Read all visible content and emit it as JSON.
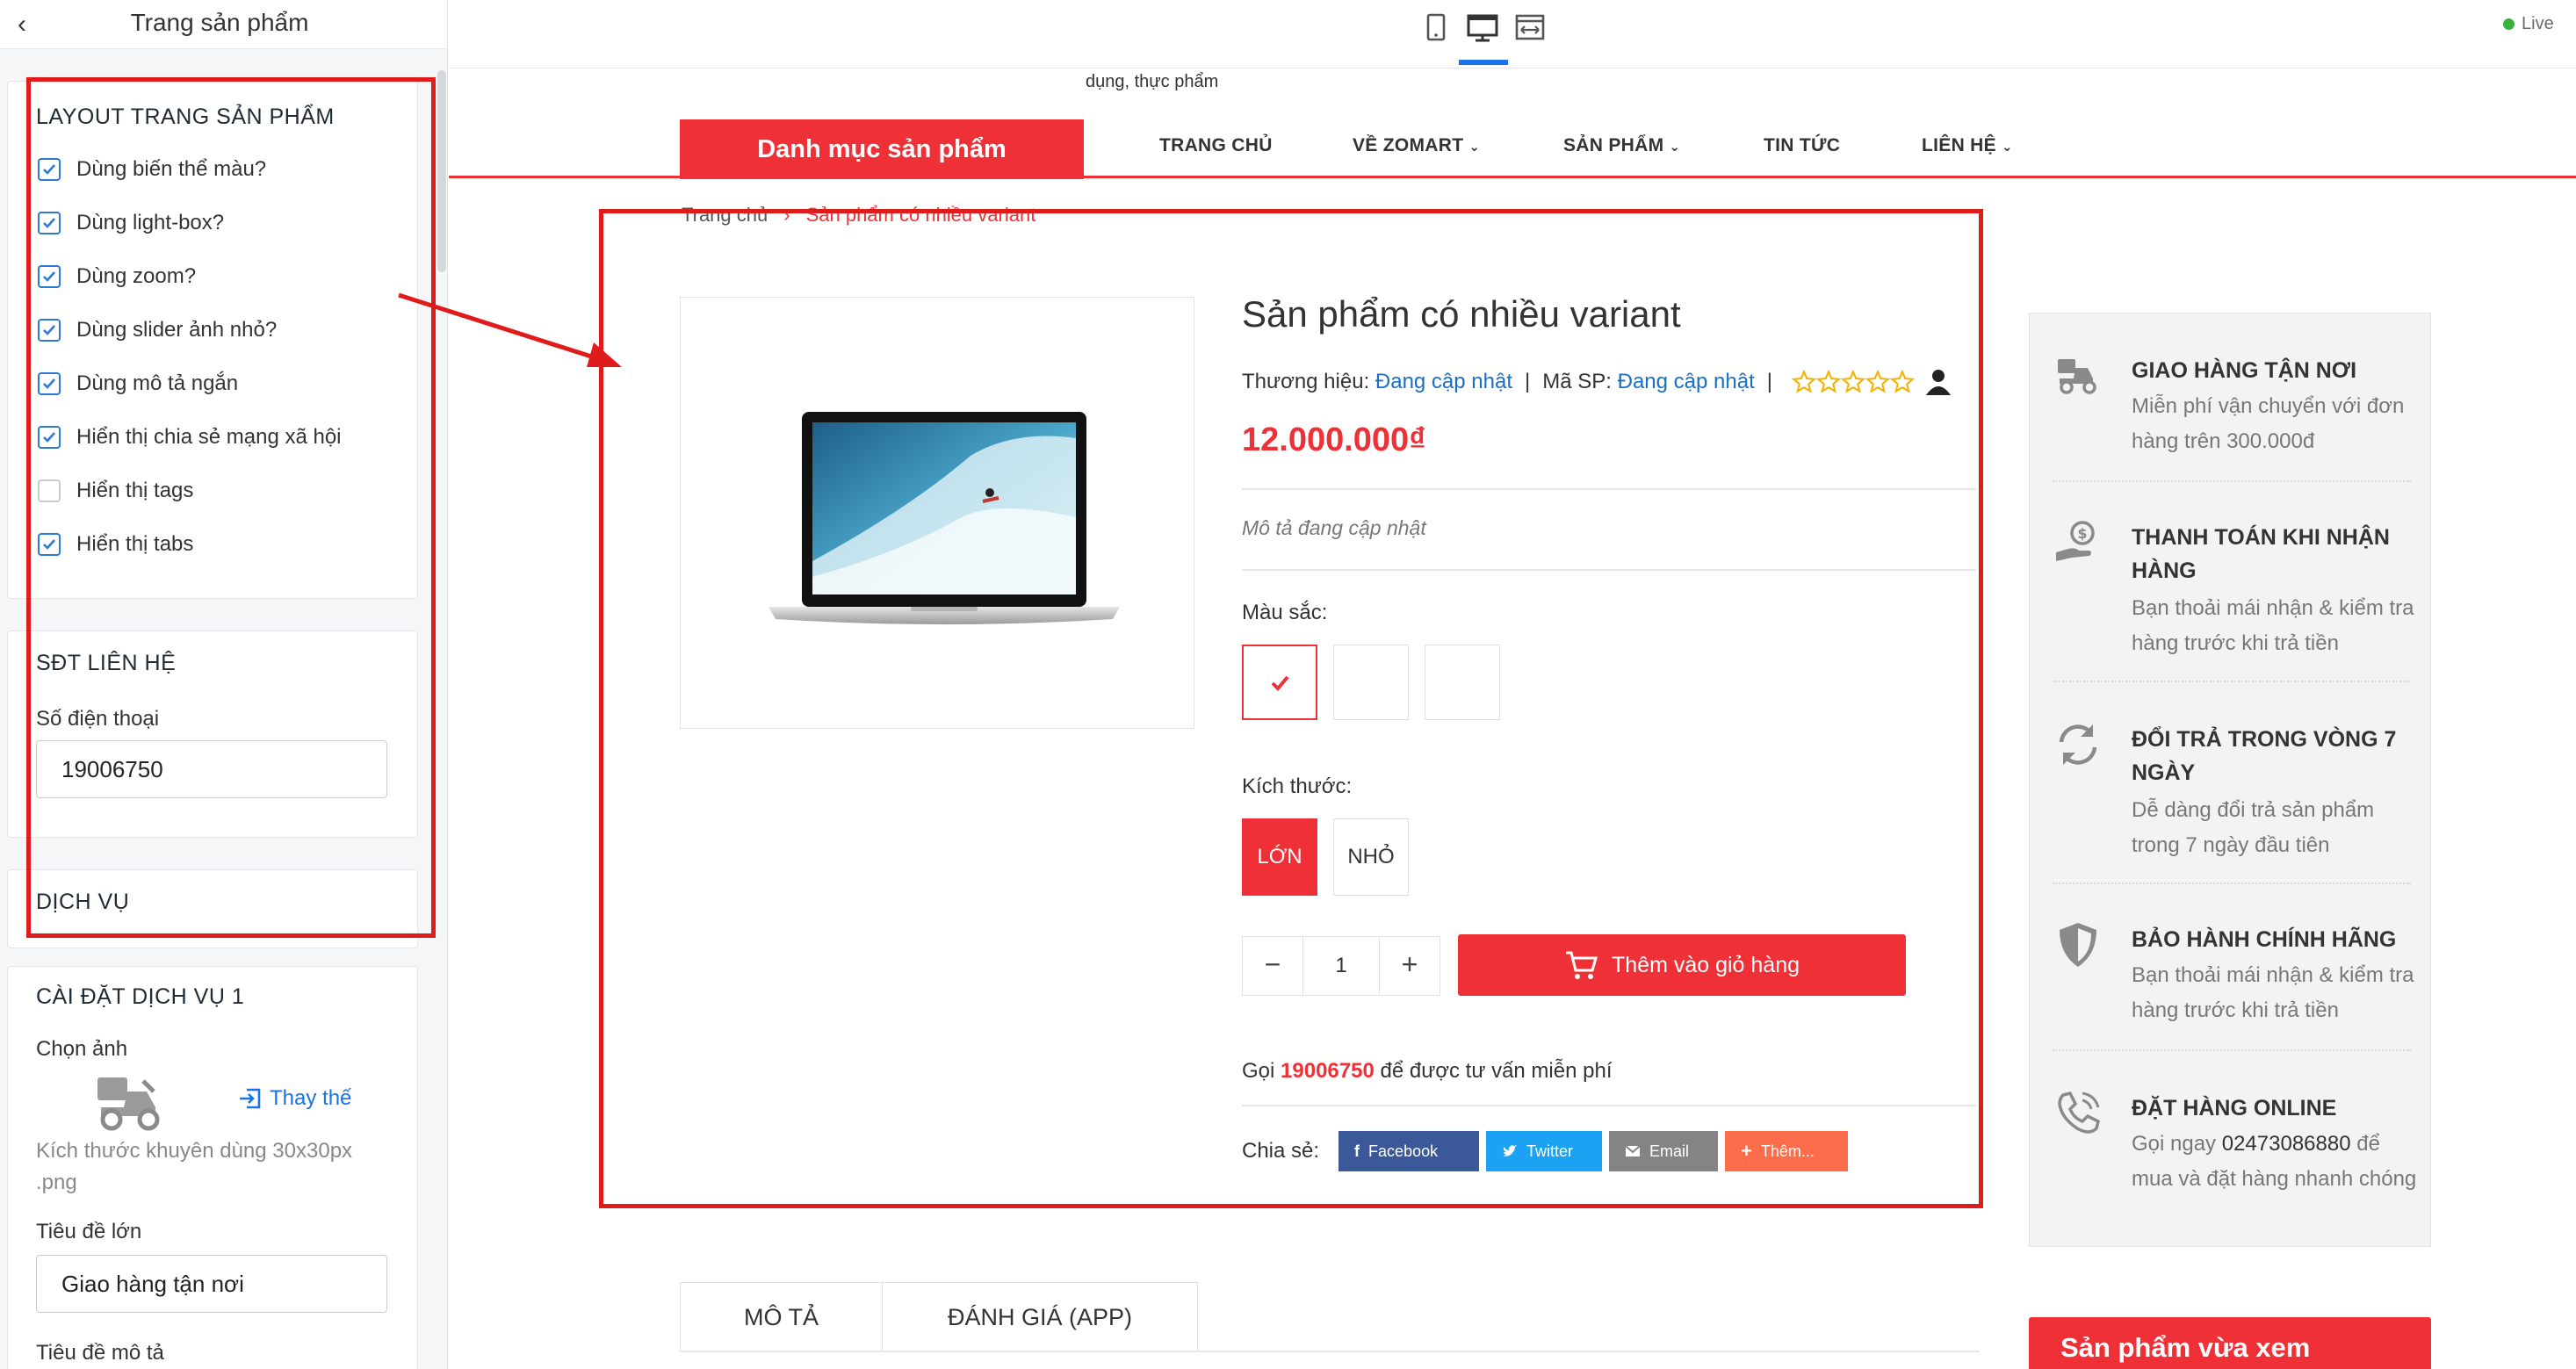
{
  "sidebar": {
    "title": "Trang sản phẩm",
    "layout_section": {
      "title": "LAYOUT TRANG SẢN PHẨM",
      "options": [
        {
          "label": "Dùng biến thể màu?",
          "checked": true
        },
        {
          "label": "Dùng light-box?",
          "checked": true
        },
        {
          "label": "Dùng zoom?",
          "checked": true
        },
        {
          "label": "Dùng slider ảnh nhỏ?",
          "checked": true
        },
        {
          "label": "Dùng mô tả ngắn",
          "checked": true
        },
        {
          "label": "Hiển thị chia sẻ mạng xã hội",
          "checked": true
        },
        {
          "label": "Hiển thị tags",
          "checked": false
        },
        {
          "label": "Hiển thị tabs",
          "checked": true
        }
      ]
    },
    "phone_section": {
      "title": "SĐT LIÊN HỆ",
      "field_label": "Số điện thoại",
      "field_value": "19006750"
    },
    "services_section": {
      "title": "DỊCH VỤ"
    },
    "service1_section": {
      "title": "CÀI ĐẶT DỊCH VỤ 1",
      "image_label": "Chọn ảnh",
      "replace_label": "Thay thế",
      "size_hint": "Kích thước khuyên dùng 30x30px .png",
      "big_title_label": "Tiêu đề lớn",
      "big_title_value": "Giao hàng tận nơi",
      "desc_title_label": "Tiêu đề mô tả"
    }
  },
  "topbar": {
    "live_label": "Live"
  },
  "site": {
    "tagline": "dụng, thực phẩm",
    "category_button": "Danh mục sản phẩm",
    "nav": [
      {
        "label": "TRANG CHỦ",
        "dropdown": false
      },
      {
        "label": "VỀ ZOMART",
        "dropdown": true
      },
      {
        "label": "SẢN PHẨM",
        "dropdown": true
      },
      {
        "label": "TIN TỨC",
        "dropdown": false
      },
      {
        "label": "LIÊN HỆ",
        "dropdown": true
      }
    ],
    "breadcrumb": {
      "home": "Trang chủ",
      "separator": "›",
      "current": "Sản phẩm có nhiều variant"
    }
  },
  "product": {
    "title": "Sản phẩm có nhiều variant",
    "brand_label": "Thương hiệu:",
    "brand_value": "Đang cập nhật",
    "sku_label": "Mã SP:",
    "sku_value": "Đang cập nhật",
    "rating": 0,
    "rating_max": 5,
    "price": "12.000.000₫",
    "description": "Mô tả đang cập nhật",
    "color_label": "Màu sắc:",
    "size_label": "Kích thước:",
    "sizes": [
      "LỚN",
      "NHỎ"
    ],
    "selected_size": "LỚN",
    "quantity": "1",
    "qty_minus": "−",
    "qty_plus": "+",
    "add_to_cart": "Thêm vào giỏ hàng",
    "call_prefix": "Gọi",
    "call_phone": "19006750",
    "call_suffix": "để được tư vấn miễn phí",
    "share_label": "Chia sẻ:",
    "share_buttons": [
      {
        "label": "Facebook",
        "color": "#3b5998"
      },
      {
        "label": "Twitter",
        "color": "#1da1f2"
      },
      {
        "label": "Email",
        "color": "#848484"
      },
      {
        "label": "Thêm...",
        "color": "#fc6d4c"
      }
    ]
  },
  "services": [
    {
      "icon": "delivery-scooter-icon",
      "title": "GIAO HÀNG TẬN NƠI",
      "desc": "Miễn phí vận chuyển với đơn hàng trên 300.000đ"
    },
    {
      "icon": "cash-hand-icon",
      "title": "THANH TOÁN KHI NHẬN HÀNG",
      "desc": "Bạn thoải mái nhận & kiểm tra hàng trước khi trả tiền"
    },
    {
      "icon": "refresh-icon",
      "title": "ĐỔI TRẢ TRONG VÒNG 7 NGÀY",
      "desc": "Dễ dàng đổi trả sản phẩm trong 7 ngày đầu tiên"
    },
    {
      "icon": "shield-icon",
      "title": "BẢO HÀNH CHÍNH HÃNG",
      "desc": "Bạn thoải mái nhận & kiểm tra hàng trước khi trả tiền"
    },
    {
      "icon": "phone-call-icon",
      "title": "ĐẶT HÀNG ONLINE",
      "desc_prefix": "Gọi ngay",
      "desc_phone": "02473086880",
      "desc_suffix": "để mua và đặt hàng nhanh chóng"
    }
  ],
  "tabs": [
    "MÔ TẢ",
    "ĐÁNH GIÁ (APP)"
  ],
  "recent_title": "Sản phẩm vừa xem",
  "colors": {
    "accent": "#ef3036",
    "link": "#1a6fc2",
    "annotation": "#e01b1b"
  }
}
